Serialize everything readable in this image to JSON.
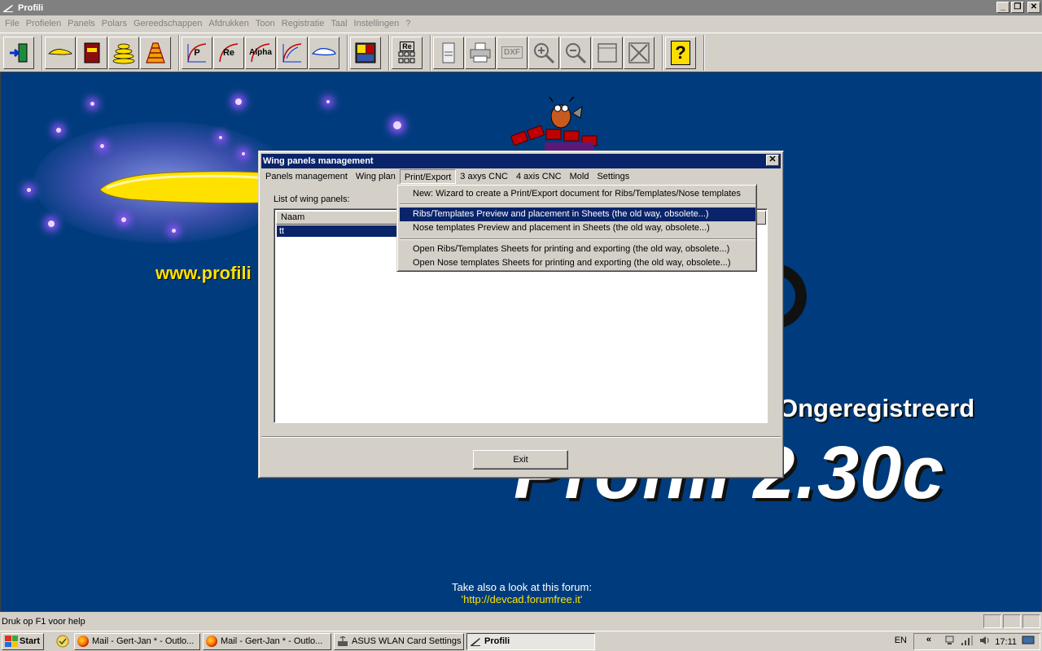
{
  "window": {
    "title": "Profili",
    "controls": {
      "minimize": "_",
      "restore": "❐",
      "close": "✕"
    }
  },
  "menubar": [
    "File",
    "Profielen",
    "Panels",
    "Polars",
    "Gereedschappen",
    "Afdrukken",
    "Toon",
    "Registratie",
    "Taal",
    "Instellingen",
    "?"
  ],
  "toolbar": {
    "group1": [
      "exit-door-icon"
    ],
    "group2": [
      "airfoil-icon",
      "database-book-icon",
      "stacked-airfoils-icon",
      "rib-structure-icon"
    ],
    "group3": [
      {
        "icon": "polar-p-icon",
        "label": "P"
      },
      {
        "icon": "polar-re-icon",
        "label": "Re"
      },
      {
        "icon": "polar-alpha-icon",
        "label": "Alpha"
      },
      {
        "icon": "polar-curve-icon",
        "label": ""
      },
      {
        "icon": "airfoil-eye-icon",
        "label": ""
      }
    ],
    "group4": [
      "calculator-chart-icon"
    ],
    "group5": [
      {
        "icon": "re-calculator-icon",
        "label": "Re"
      }
    ],
    "group6": [
      {
        "icon": "print-preview-icon",
        "label": ""
      },
      {
        "icon": "printer-icon",
        "label": ""
      },
      {
        "icon": "dxf-export-icon",
        "label": "DXF"
      },
      {
        "icon": "zoom-in-icon",
        "label": ""
      },
      {
        "icon": "zoom-out-icon",
        "label": ""
      },
      {
        "icon": "zoom-window-icon",
        "label": ""
      },
      {
        "icon": "zoom-fit-icon",
        "label": ""
      }
    ],
    "group7": [
      {
        "icon": "help-icon",
        "label": "?"
      }
    ]
  },
  "splash": {
    "url": "www.profili",
    "unregistered": "Ongeregistreerd",
    "version": "Profili 2.30c",
    "forum_text": "Take also a look at this forum:",
    "forum_link": "'http://devcad.forumfree.it'"
  },
  "dialog": {
    "title": "Wing panels management",
    "close": "✕",
    "menu": [
      "Panels management",
      "Wing plan",
      "Print/Export",
      "3 axys CNC",
      "4 axis CNC",
      "Mold",
      "Settings"
    ],
    "list_label": "List of wing panels:",
    "column_header": "Naam",
    "rows": [
      "tt"
    ],
    "exit_label": "Exit"
  },
  "dropdown": {
    "items": [
      "New: Wizard to create a Print/Export document for Ribs/Templates/Nose templates",
      "Ribs/Templates Preview and  placement in Sheets (the old way, obsolete...)",
      "Nose templates Preview and  placement in Sheets (the old way, obsolete...)",
      "Open Ribs/Templates Sheets for printing and exporting (the old way, obsolete...)",
      "Open Nose templates Sheets for printing and exporting (the old way, obsolete...)"
    ],
    "highlighted_index": 1
  },
  "statusbar": {
    "text": "Druk op F1 voor help"
  },
  "taskbar": {
    "start": "Start",
    "items": [
      {
        "label": "Mail - Gert-Jan * - Outlo...",
        "icon": "firefox-icon"
      },
      {
        "label": "Mail - Gert-Jan * - Outlo...",
        "icon": "firefox-icon"
      },
      {
        "label": "ASUS WLAN Card Settings",
        "icon": "wlan-icon"
      },
      {
        "label": "Profili",
        "icon": "profili-icon",
        "active": true
      }
    ],
    "language": "EN",
    "chevron": "«",
    "clock": "17:11"
  },
  "colors": {
    "splash_bg": "#003c7d",
    "highlight": "#0a246a",
    "yellow": "#ffe100"
  }
}
